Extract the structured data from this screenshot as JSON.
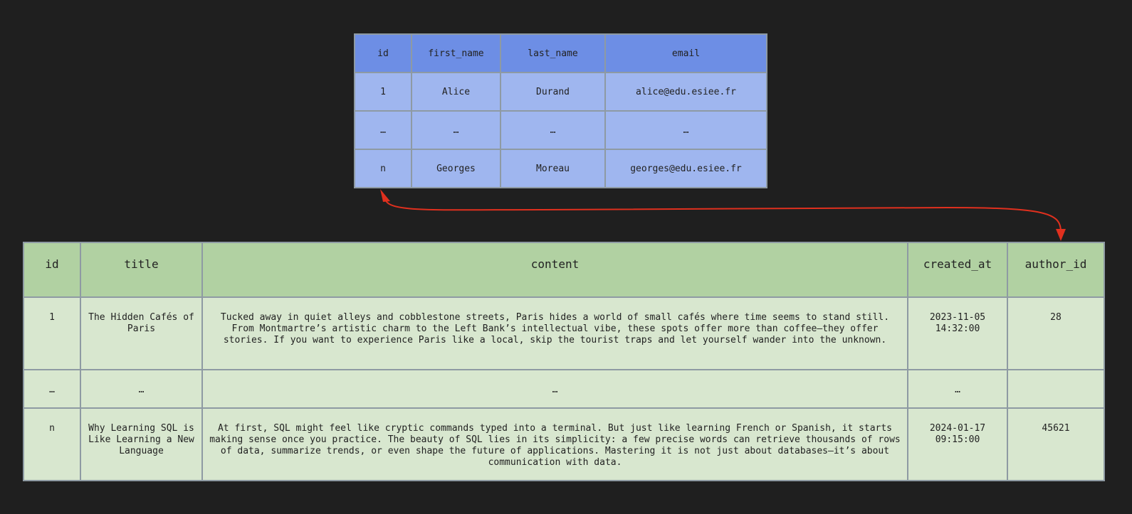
{
  "users": {
    "columns": [
      "id",
      "first_name",
      "last_name",
      "email"
    ],
    "rows": [
      [
        "1",
        "Alice",
        "Durand",
        "alice@edu.esiee.fr"
      ],
      [
        "…",
        "…",
        "…",
        "…"
      ],
      [
        "n",
        "Georges",
        "Moreau",
        "georges@edu.esiee.fr"
      ]
    ]
  },
  "posts": {
    "columns": [
      "id",
      "title",
      "content",
      "created_at",
      "author_id"
    ],
    "rows": [
      [
        "1",
        "The Hidden Cafés of Paris",
        "Tucked away in quiet alleys and cobblestone streets, Paris hides a world of small cafés where time seems to stand still. From Montmartre’s artistic charm to the Left Bank’s intellectual vibe, these spots offer more than coffee—they offer stories. If you want to experience Paris like a local, skip the tourist traps and let yourself wander into the unknown.",
        "2023-11-05 14:32:00",
        "28"
      ],
      [
        "…",
        "…",
        "…",
        "…",
        ""
      ],
      [
        "n",
        "Why Learning SQL is Like Learning a New Language",
        "At first, SQL might feel like cryptic commands typed into a terminal. But just like learning French or Spanish, it starts making sense once you practice. The beauty of SQL lies in its simplicity: a few precise words can retrieve thousands of rows of data, summarize trends, or even shape the future of applications. Mastering it is not just about databases—it’s about communication with data.",
        "2024-01-17 09:15:00",
        "45621"
      ]
    ]
  },
  "colors": {
    "users_header": "#6d8ee5",
    "users_cell": "#9fb6ef",
    "posts_header": "#b1d1a2",
    "posts_cell": "#d8e7cf",
    "relation_arrow": "#e0301e",
    "background": "#1f1f1f"
  }
}
